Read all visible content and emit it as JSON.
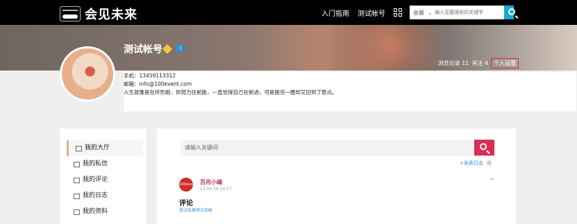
{
  "top": {
    "logo_text": "会见未来",
    "nav": [
      "入门指南",
      "测试帐号"
    ],
    "search_scope": "会展",
    "search_placeholder": "输入您要搜索的关键字"
  },
  "profile": {
    "name": "测试帐号",
    "browse": "浏览记录 11",
    "follow": "关注 4",
    "settings": "个人设置",
    "phone": "手机：13459113312",
    "email": "邮箱：info@100event.com",
    "bio": "人生就像是在环形跑，你努力往前跑，一直觉得自己在前进，可是跑完一圈却又回到了原点。"
  },
  "left_menu": [
    "我的大厅",
    "我的私信",
    "我的评论",
    "我的日志",
    "我的资料"
  ],
  "main": {
    "keyword_placeholder": "请输入关键词",
    "post_log": "+发表日志",
    "author": "百兆小编",
    "time": "23.04.19 14:27",
    "comment_title": "评论",
    "comment_link": "测试会展测试功能",
    "avatar_text": "100event"
  }
}
